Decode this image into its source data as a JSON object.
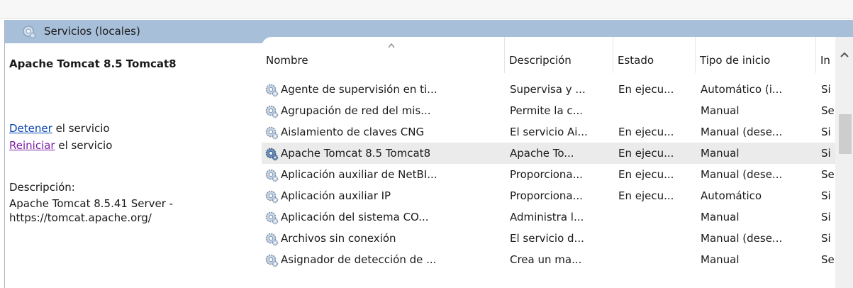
{
  "header": {
    "title": "Servicios (locales)"
  },
  "left_panel": {
    "service_title": "Apache Tomcat 8.5 Tomcat8",
    "stop_link": "Detener",
    "stop_suffix": " el servicio",
    "restart_link": "Reiniciar",
    "restart_suffix": " el servicio",
    "description_label": "Descripción:",
    "description_line1": "Apache Tomcat 8.5.41 Server -",
    "description_line2": "https://tomcat.apache.org/"
  },
  "columns": [
    "Nombre",
    "Descripción",
    "Estado",
    "Tipo de inicio",
    "In"
  ],
  "rows": [
    {
      "name": "Agente de supervisión en ti...",
      "desc": "Supervisa y ...",
      "state": "En ejecu...",
      "start": "Automático (i...",
      "in": "Si"
    },
    {
      "name": "Agrupación de red del mis...",
      "desc": "Permite la c...",
      "state": "",
      "start": "Manual",
      "in": "Se"
    },
    {
      "name": "Aislamiento de claves CNG",
      "desc": "El servicio Ai...",
      "state": "En ejecu...",
      "start": "Manual (dese...",
      "in": "Si"
    },
    {
      "name": "Apache Tomcat 8.5 Tomcat8",
      "desc": "Apache To...",
      "state": "En ejecu...",
      "start": "Manual",
      "in": "Si"
    },
    {
      "name": "Aplicación auxiliar de NetBI...",
      "desc": "Proporciona...",
      "state": "En ejecu...",
      "start": "Manual (dese...",
      "in": "Se"
    },
    {
      "name": "Aplicación auxiliar IP",
      "desc": "Proporciona...",
      "state": "En ejecu...",
      "start": "Automático",
      "in": "Si"
    },
    {
      "name": "Aplicación del sistema CO...",
      "desc": "Administra l...",
      "state": "",
      "start": "Manual",
      "in": "Si"
    },
    {
      "name": "Archivos sin conexión",
      "desc": "El servicio d...",
      "state": "",
      "start": "Manual (dese...",
      "in": "Si"
    },
    {
      "name": "Asignador de detección de ...",
      "desc": "Crea un ma...",
      "state": "",
      "start": "Manual",
      "in": "Se"
    }
  ],
  "selected_row_index": 3,
  "icons": {
    "header": "services-icon",
    "row": "gear-icon",
    "sort": "sort-ascending-icon",
    "scroll_up": "chevron-up-icon"
  },
  "colors": {
    "header_bg": "#a7bfd9",
    "link": "#0645ad",
    "visited_link": "#7a1fa2",
    "selected_row": "#ebebeb"
  }
}
